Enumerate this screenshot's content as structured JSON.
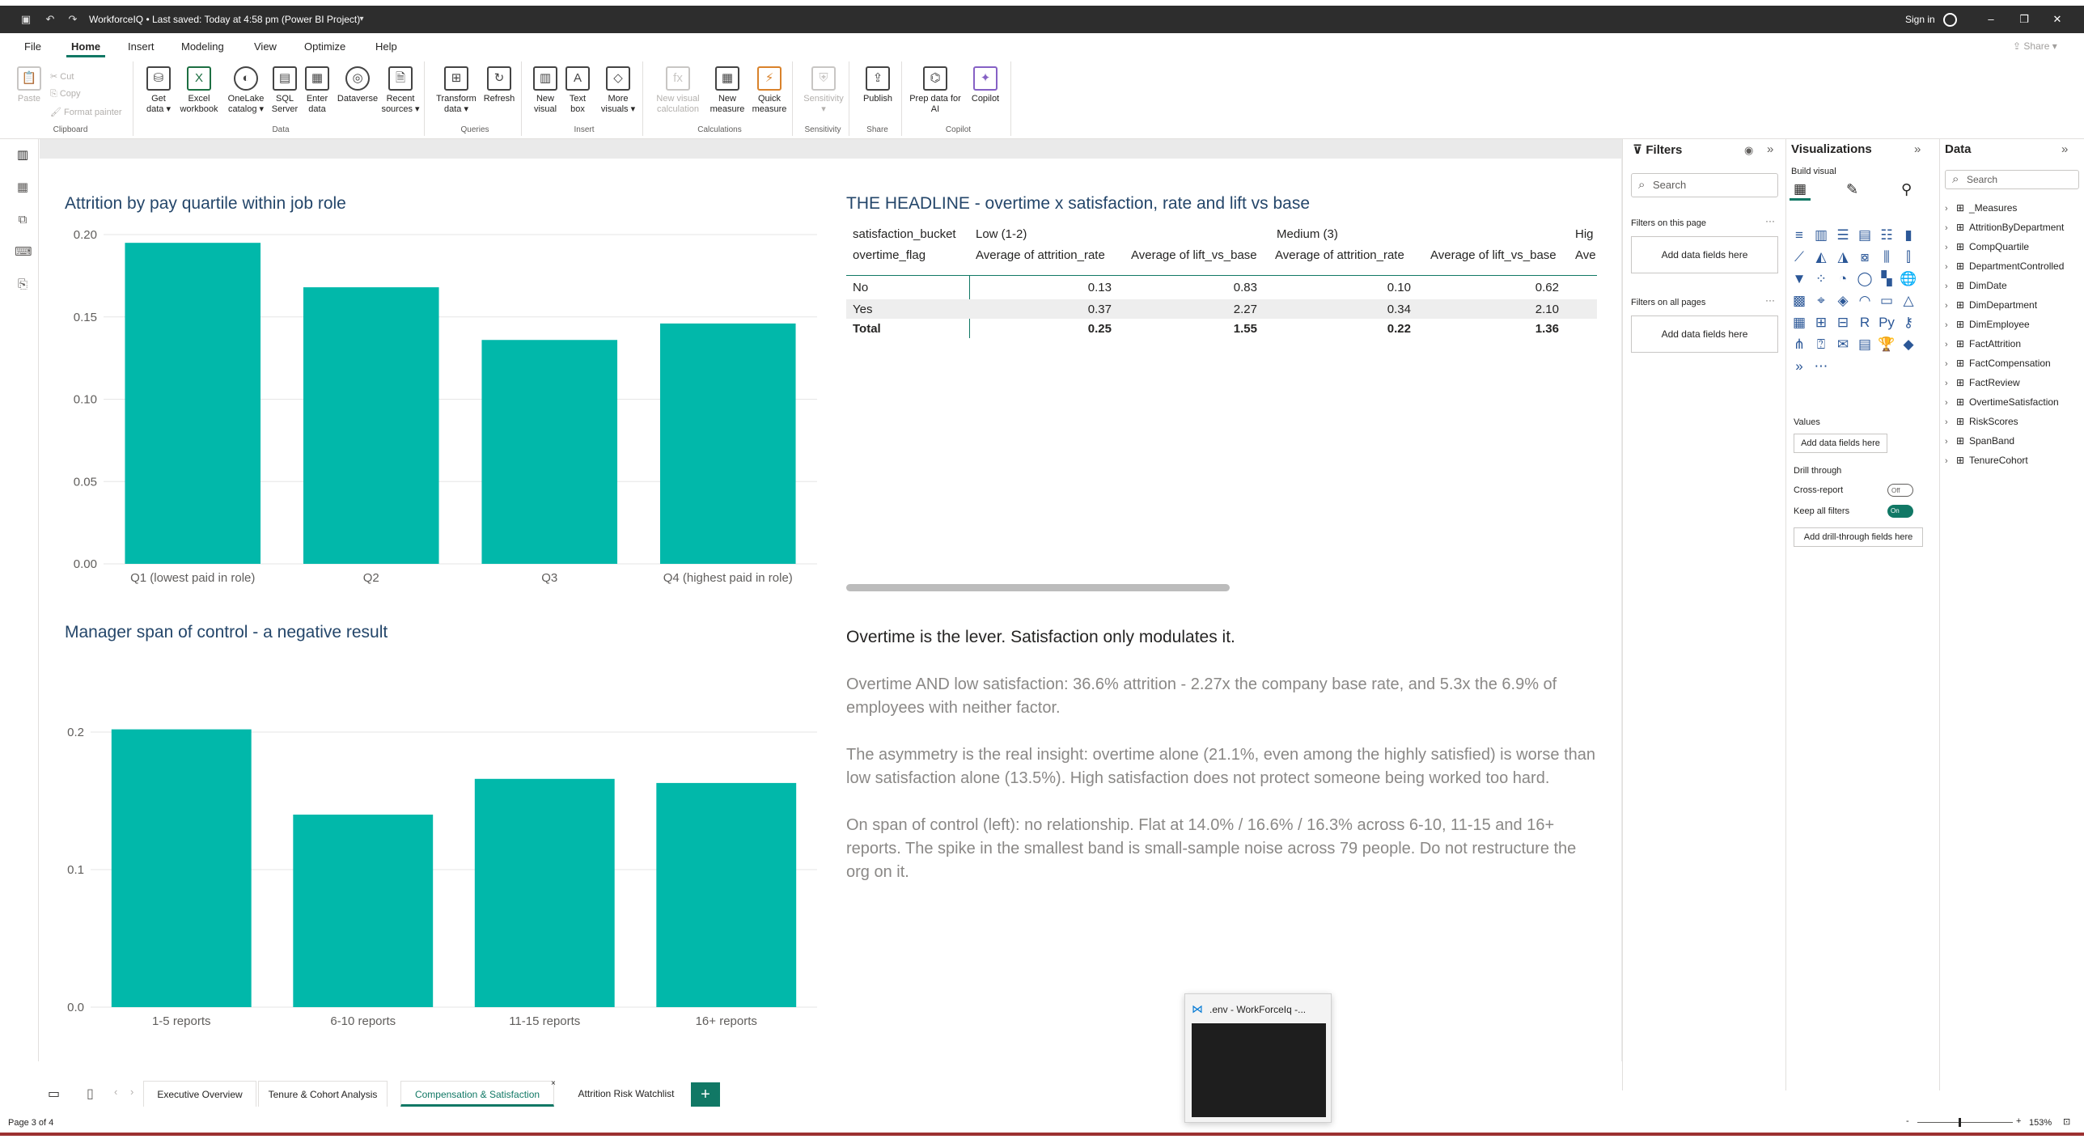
{
  "titlebar": {
    "title": "WorkforceIQ • Last saved: Today at 4:58 pm (Power BI Project)",
    "signin": "Sign in"
  },
  "menu": {
    "tabs": [
      "File",
      "Home",
      "Insert",
      "Modeling",
      "View",
      "Optimize",
      "Help"
    ],
    "active": "Home",
    "share": "Share"
  },
  "ribbon": {
    "clipboard": {
      "paste": "Paste",
      "cut": "Cut",
      "copy": "Copy",
      "format_painter": "Format painter",
      "label": "Clipboard"
    },
    "data": {
      "label": "Data",
      "buttons": [
        "Get data",
        "Excel workbook",
        "OneLake catalog",
        "SQL Server",
        "Enter data",
        "Dataverse",
        "Recent sources"
      ]
    },
    "queries": {
      "label": "Queries",
      "buttons": [
        "Transform data",
        "Refresh"
      ]
    },
    "insert": {
      "label": "Insert",
      "buttons": [
        "New visual",
        "Text box",
        "More visuals"
      ]
    },
    "calculations": {
      "label": "Calculations",
      "buttons": [
        "New visual calculation",
        "New measure",
        "Quick measure"
      ]
    },
    "sensitivity": {
      "label": "Sensitivity",
      "buttons": [
        "Sensitivity"
      ]
    },
    "share": {
      "label": "Share",
      "buttons": [
        "Publish"
      ]
    },
    "copilot": {
      "label": "Copilot",
      "buttons": [
        "Prep data for AI",
        "Copilot"
      ]
    }
  },
  "visual1": {
    "title": "Attrition by pay quartile within job role",
    "chart_data": {
      "type": "bar",
      "categories": [
        "Q1 (lowest paid in role)",
        "Q2",
        "Q3",
        "Q4 (highest paid in role)"
      ],
      "values": [
        0.195,
        0.168,
        0.136,
        0.146
      ],
      "yticks": [
        "0.00",
        "0.05",
        "0.10",
        "0.15",
        "0.20"
      ],
      "ylim": [
        0,
        0.2
      ],
      "color": "#01b8aa"
    }
  },
  "visual2": {
    "title": "Manager span of control - a negative result",
    "chart_data": {
      "type": "bar",
      "categories": [
        "1-5 reports",
        "6-10 reports",
        "11-15 reports",
        "16+ reports"
      ],
      "values": [
        0.202,
        0.14,
        0.166,
        0.163
      ],
      "yticks": [
        "0.0",
        "0.1",
        "0.2"
      ],
      "ylim": [
        0,
        0.2
      ],
      "color": "#01b8aa"
    }
  },
  "matrix": {
    "title": "THE HEADLINE - overtime x satisfaction, rate and lift vs base",
    "row_header_1": "satisfaction_bucket",
    "row_header_2": "overtime_flag",
    "groups": [
      "Low (1-2)",
      "Medium (3)",
      "Hig"
    ],
    "col_headers": [
      "Average of attrition_rate",
      "Average of lift_vs_base",
      "Average of attrition_rate",
      "Average of lift_vs_base",
      "Ave"
    ],
    "rows": [
      {
        "label": "No",
        "values": [
          "0.13",
          "0.83",
          "0.10",
          "0.62"
        ]
      },
      {
        "label": "Yes",
        "values": [
          "0.37",
          "2.27",
          "0.34",
          "2.10"
        ]
      },
      {
        "label": "Total",
        "values": [
          "0.25",
          "1.55",
          "0.22",
          "1.36"
        ]
      }
    ]
  },
  "textbox": {
    "heading": "Overtime is the lever. Satisfaction only modulates it.",
    "p1": "Overtime AND low satisfaction: 36.6% attrition - 2.27x the company base rate, and 5.3x the 6.9% of employees with neither factor.",
    "p2": "The asymmetry is the real insight: overtime alone (21.1%, even among the highly satisfied) is worse than low satisfaction alone (13.5%). High satisfaction does not protect someone being worked too hard.",
    "p3": "On span of control (left): no relationship. Flat at 14.0% / 16.6% / 16.3% across 6-10, 11-15 and 16+ reports. The spike in the smallest band is small-sample noise across 79 people. Do not restructure the org on it."
  },
  "filters": {
    "title": "Filters",
    "search": "Search",
    "on_page": "Filters on this page",
    "on_all": "Filters on all pages",
    "add": "Add data fields here"
  },
  "viz": {
    "title": "Visualizations",
    "build": "Build visual",
    "values": "Values",
    "add_values": "Add data fields here",
    "drill": "Drill through",
    "cross": "Cross-report",
    "cross_state": "Off",
    "keep": "Keep all filters",
    "keep_state": "On",
    "add_drill": "Add drill-through fields here"
  },
  "data": {
    "title": "Data",
    "search": "Search",
    "tables": [
      "_Measures",
      "AttritionByDepartment",
      "CompQuartile",
      "DepartmentControlled",
      "DimDate",
      "DimDepartment",
      "DimEmployee",
      "FactAttrition",
      "FactCompensation",
      "FactReview",
      "OvertimeSatisfaction",
      "RiskScores",
      "SpanBand",
      "TenureCohort"
    ]
  },
  "pages": {
    "tabs": [
      "Executive Overview",
      "Tenure & Cohort Analysis",
      "Compensation & Satisfaction",
      "Attrition Risk Watchlist"
    ],
    "active": "Compensation & Satisfaction",
    "status": "Page 3 of 4",
    "zoom": "153%"
  },
  "taskbar_preview": {
    "title": ".env - WorkForceIq -..."
  }
}
